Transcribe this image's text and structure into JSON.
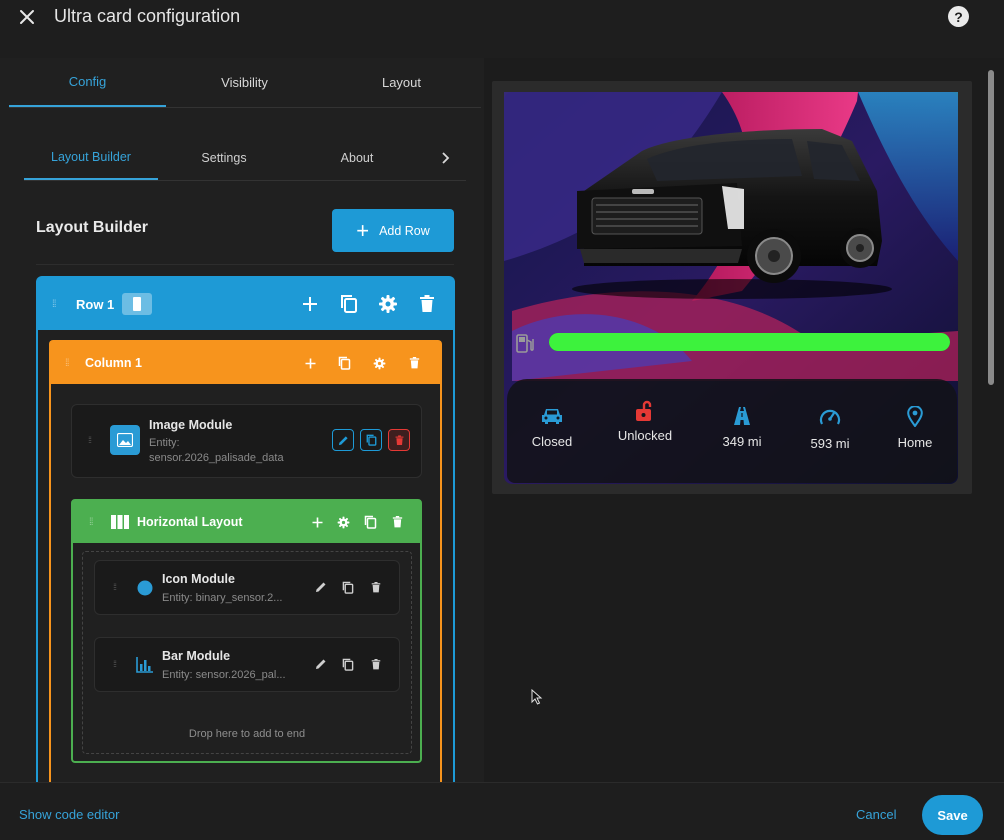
{
  "dialog": {
    "title": "Ultra card configuration"
  },
  "main_tabs": [
    {
      "label": "Config"
    },
    {
      "label": "Visibility"
    },
    {
      "label": "Layout"
    }
  ],
  "sub_tabs": [
    {
      "label": "Layout Builder"
    },
    {
      "label": "Settings"
    },
    {
      "label": "About"
    }
  ],
  "builder": {
    "heading": "Layout Builder",
    "add_row_label": "Add Row",
    "row": {
      "title": "Row 1"
    },
    "column": {
      "title": "Column 1"
    },
    "image_module": {
      "title": "Image Module",
      "entity_line1": "Entity:",
      "entity_line2": "sensor.2026_palisade_data"
    },
    "horizontal_layout": {
      "title": "Horizontal Layout",
      "modules": [
        {
          "title": "Icon Module",
          "entity": "Entity: binary_sensor.2..."
        },
        {
          "title": "Bar Module",
          "entity": "Entity: sensor.2026_pal..."
        }
      ],
      "drop_hint": "Drop here to add to end"
    }
  },
  "preview": {
    "fuel_level": 1.0,
    "bar_color": "#3df23d",
    "status_items": [
      {
        "icon": "car-icon",
        "label": "Closed",
        "color": "#2a9bd5"
      },
      {
        "icon": "unlock-icon",
        "label": "Unlocked",
        "color": "#e53935"
      },
      {
        "icon": "road-icon",
        "label": "349 mi",
        "color": "#2a9bd5"
      },
      {
        "icon": "speedometer-icon",
        "label": "593 mi",
        "color": "#2a9bd5"
      },
      {
        "icon": "location-pin-icon",
        "label": "Home",
        "color": "#2a9bd5"
      }
    ]
  },
  "footer": {
    "code_editor_label": "Show code editor",
    "cancel_label": "Cancel",
    "save_label": "Save"
  },
  "colors": {
    "accent": "#1e9ad6",
    "column": "#f7941d",
    "layout": "#4caf50",
    "danger": "#e53935"
  }
}
